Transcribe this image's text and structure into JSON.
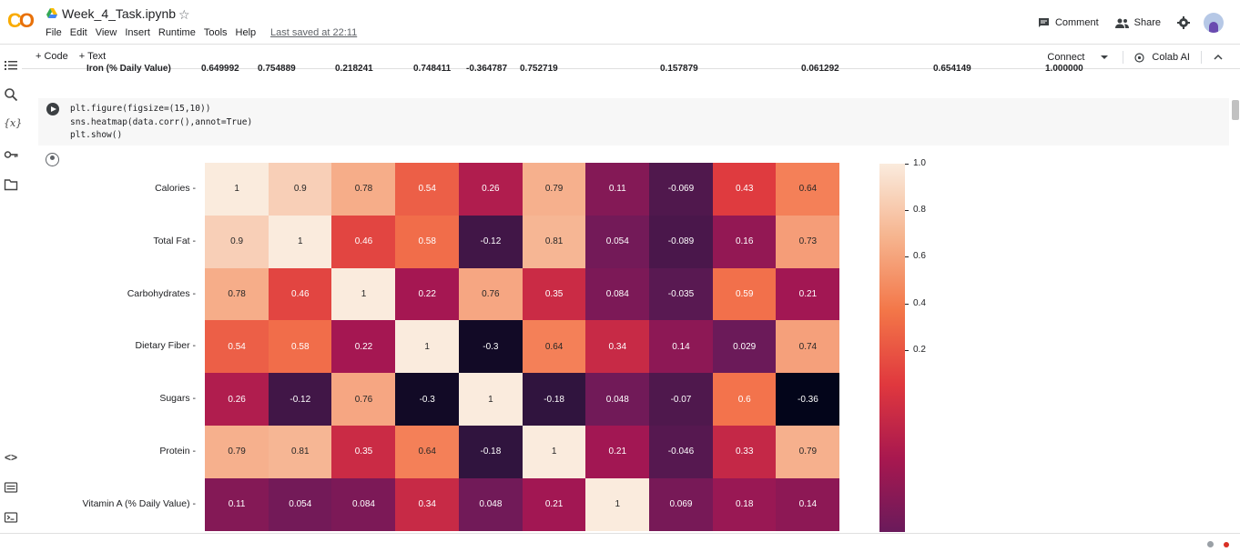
{
  "header": {
    "title": "Week_4_Task.ipynb",
    "menu": [
      "File",
      "Edit",
      "View",
      "Insert",
      "Runtime",
      "Tools",
      "Help"
    ],
    "last_saved": "Last saved at 22:11",
    "comment_label": "Comment",
    "share_label": "Share"
  },
  "toolbar": {
    "code_label": "+ Code",
    "text_label": "+ Text",
    "connect_label": "Connect",
    "colab_ai_label": "Colab AI"
  },
  "cut_row": {
    "label": "Iron (% Daily Value)",
    "values": [
      "0.649992",
      "0.754889",
      "0.218241",
      "0.748411",
      "-0.364787",
      "0.752719",
      "0.157879",
      "0.061292",
      "0.654149",
      "1.000000"
    ]
  },
  "cell": {
    "code_lines": [
      "plt.figure(figsize=(15,10))",
      "sns.heatmap(data.corr(),annot=True)",
      "plt.show()"
    ]
  },
  "chart_data": {
    "type": "heatmap",
    "rows": [
      "Calories",
      "Total Fat",
      "Carbohydrates",
      "Dietary Fiber",
      "Sugars",
      "Protein",
      "Vitamin A (% Daily Value)"
    ],
    "values": [
      [
        1,
        0.9,
        0.78,
        0.54,
        0.26,
        0.79,
        0.11,
        -0.069,
        0.43,
        0.64
      ],
      [
        0.9,
        1,
        0.46,
        0.58,
        -0.12,
        0.81,
        0.054,
        -0.089,
        0.16,
        0.73
      ],
      [
        0.78,
        0.46,
        1,
        0.22,
        0.76,
        0.35,
        0.084,
        -0.035,
        0.59,
        0.21
      ],
      [
        0.54,
        0.58,
        0.22,
        1,
        -0.3,
        0.64,
        0.34,
        0.14,
        0.029,
        0.74
      ],
      [
        0.26,
        -0.12,
        0.76,
        -0.3,
        1,
        -0.18,
        0.048,
        -0.07,
        0.6,
        -0.36
      ],
      [
        0.79,
        0.81,
        0.35,
        0.64,
        -0.18,
        1,
        0.21,
        -0.046,
        0.33,
        0.79
      ],
      [
        0.11,
        0.054,
        0.084,
        0.34,
        0.048,
        0.21,
        1,
        0.069,
        0.18,
        0.14
      ]
    ],
    "colorbar_ticks": [
      "1.0",
      "0.8",
      "0.6",
      "0.4",
      "0.2"
    ],
    "colorbar_range": [
      -0.36,
      1.0
    ],
    "colormap": "rocket"
  }
}
